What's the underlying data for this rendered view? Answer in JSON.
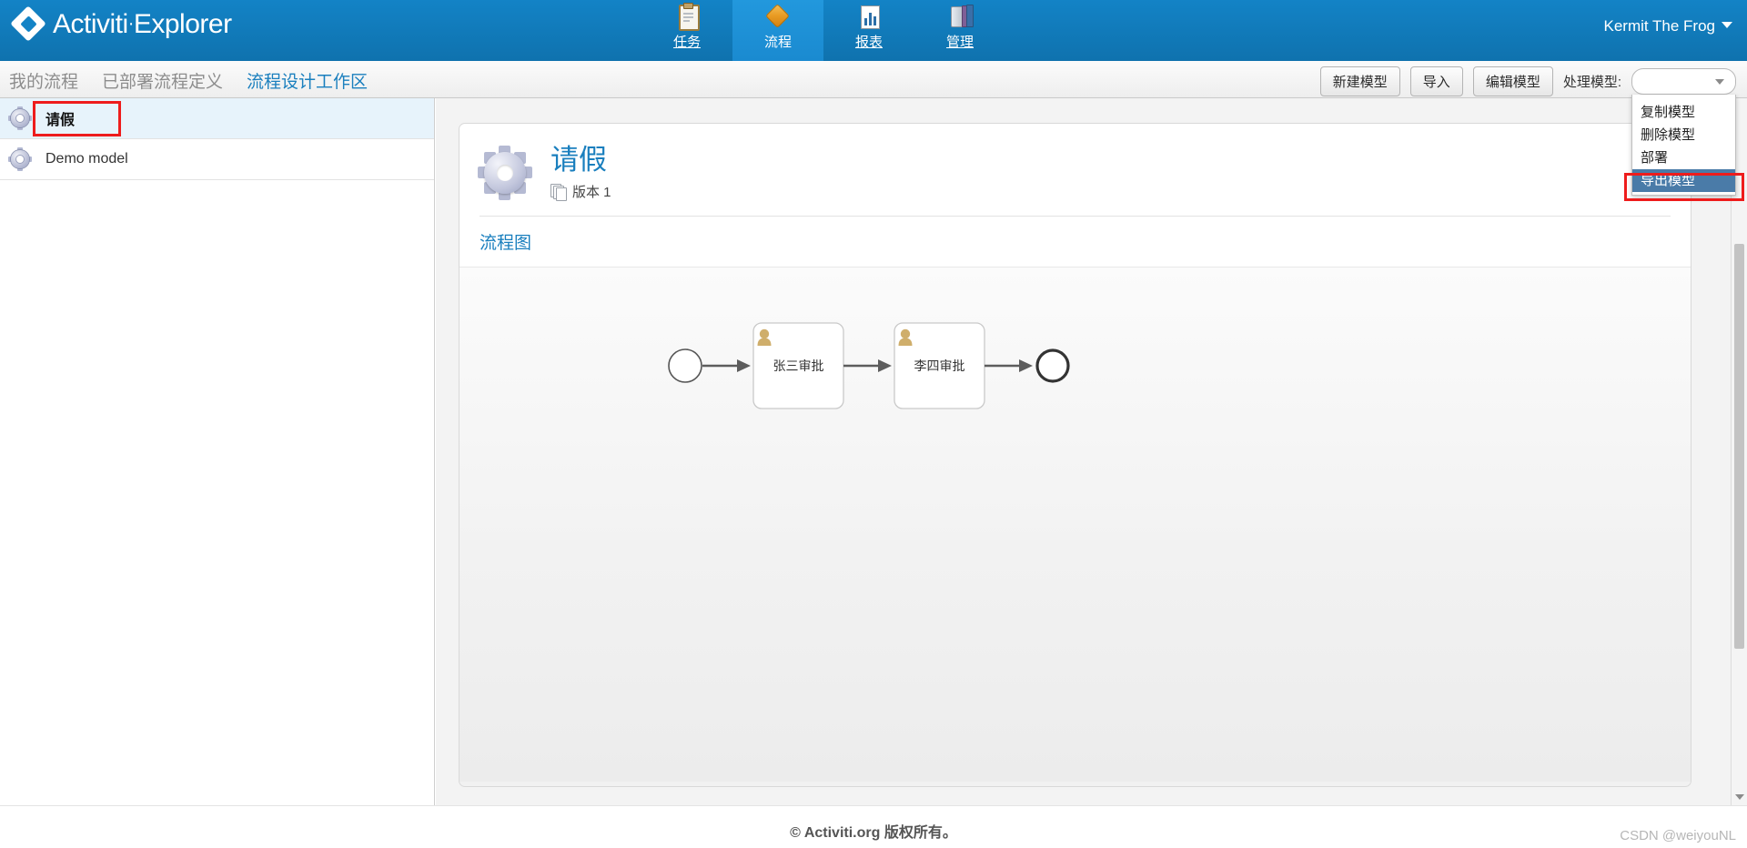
{
  "header": {
    "brand_primary": "Activiti",
    "brand_separator": "·",
    "brand_secondary": "Explorer",
    "brand_icon": "diamond-logo-icon",
    "user_name": "Kermit The Frog",
    "user_caret_icon": "caret-down-icon",
    "tabs": [
      {
        "label": "任务",
        "icon": "clipboard-icon",
        "active": false
      },
      {
        "label": "流程",
        "icon": "diamond-icon",
        "active": true
      },
      {
        "label": "报表",
        "icon": "bar-chart-icon",
        "active": false
      },
      {
        "label": "管理",
        "icon": "admin-books-icon",
        "active": false
      }
    ]
  },
  "subnav": {
    "links": [
      {
        "label": "我的流程",
        "active": false
      },
      {
        "label": "已部署流程定义",
        "active": false
      },
      {
        "label": "流程设计工作区",
        "active": true
      }
    ],
    "toolbar": {
      "new_model_label": "新建模型",
      "import_label": "导入",
      "edit_model_label": "编辑模型",
      "process_model_label": "处理模型:",
      "select_value": "",
      "select_caret_icon": "caret-down-icon"
    }
  },
  "dropdown": {
    "open": true,
    "items": [
      {
        "label": "复制模型",
        "selected": false
      },
      {
        "label": "删除模型",
        "selected": false
      },
      {
        "label": "部署",
        "selected": false
      },
      {
        "label": "导出模型",
        "selected": true
      }
    ],
    "highlight_color": "#ee1c1c",
    "selection_color": "#4a7ba8"
  },
  "sidebar": {
    "items": [
      {
        "label": "请假",
        "icon": "gear-icon",
        "active": true,
        "highlighted": true
      },
      {
        "label": "Demo model",
        "icon": "gear-icon",
        "active": false,
        "highlighted": false
      }
    ]
  },
  "main": {
    "model_icon": "gear-icon",
    "model_title": "请假",
    "version_icon": "copies-icon",
    "version_text": "版本 1",
    "section_link": "流程图",
    "diagram": {
      "type": "bpmn",
      "start_event": {
        "name": "start-event",
        "shape": "circle"
      },
      "tasks": [
        {
          "label": "张三审批",
          "icon": "user-task-icon"
        },
        {
          "label": "李四审批",
          "icon": "user-task-icon"
        }
      ],
      "end_event": {
        "name": "end-event",
        "shape": "thick-circle"
      },
      "flow_count": 3
    }
  },
  "footer": {
    "copyright": "© Activiti.org 版权所有。",
    "watermark": "CSDN @weiyouNL"
  },
  "colors": {
    "header_blue": "#1383c6",
    "link_blue": "#1a7fbe",
    "active_tab_blue": "#2298dd",
    "highlight_red": "#ee1c1c",
    "sidebar_active_bg": "#e7f3fb"
  }
}
